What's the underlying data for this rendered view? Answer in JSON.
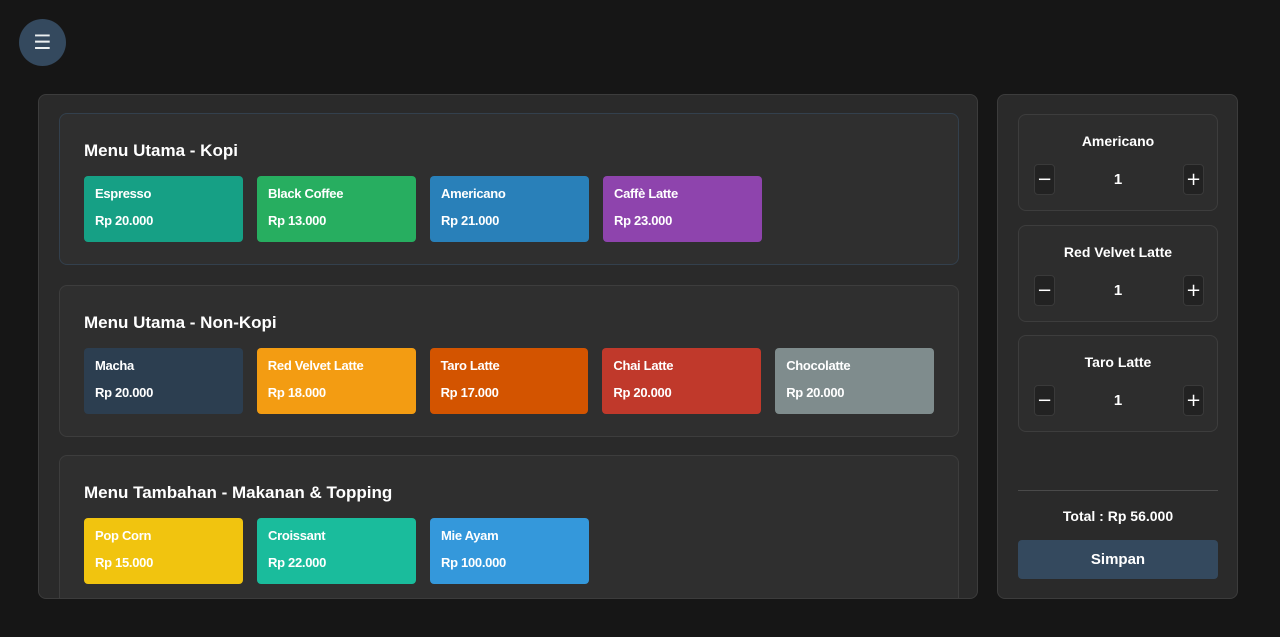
{
  "menu_toggle": {
    "icon": "hamburger-icon",
    "glyph": "☰"
  },
  "categories": [
    {
      "title": "Menu Utama - Kopi",
      "items": [
        {
          "name": "Espresso",
          "price": "Rp 20.000",
          "color": "#16a085"
        },
        {
          "name": "Black Coffee",
          "price": "Rp 13.000",
          "color": "#27ae60"
        },
        {
          "name": "Americano",
          "price": "Rp 21.000",
          "color": "#2980b9"
        },
        {
          "name": "Caffè Latte",
          "price": "Rp 23.000",
          "color": "#8e44ad"
        }
      ]
    },
    {
      "title": "Menu Utama - Non-Kopi",
      "items": [
        {
          "name": "Macha",
          "price": "Rp 20.000",
          "color": "#2c3e50"
        },
        {
          "name": "Red Velvet Latte",
          "price": "Rp 18.000",
          "color": "#f39c12"
        },
        {
          "name": "Taro Latte",
          "price": "Rp 17.000",
          "color": "#d35400"
        },
        {
          "name": "Chai Latte",
          "price": "Rp 20.000",
          "color": "#c0392b"
        },
        {
          "name": "Chocolatte",
          "price": "Rp 20.000",
          "color": "#7f8c8d"
        }
      ]
    },
    {
      "title": "Menu Tambahan - Makanan & Topping",
      "items": [
        {
          "name": "Pop Corn",
          "price": "Rp 15.000",
          "color": "#f1c40f"
        },
        {
          "name": "Croissant",
          "price": "Rp 22.000",
          "color": "#1abc9c"
        },
        {
          "name": "Mie Ayam",
          "price": "Rp 100.000",
          "color": "#3498db"
        }
      ]
    }
  ],
  "cart": {
    "items": [
      {
        "name": "Americano",
        "qty": "1",
        "minus": "−",
        "plus": "+"
      },
      {
        "name": "Red Velvet Latte",
        "qty": "1",
        "minus": "−",
        "plus": "+"
      },
      {
        "name": "Taro Latte",
        "qty": "1",
        "minus": "−",
        "plus": "+"
      }
    ],
    "total_label": "Total : Rp 56.000",
    "save_label": "Simpan"
  }
}
